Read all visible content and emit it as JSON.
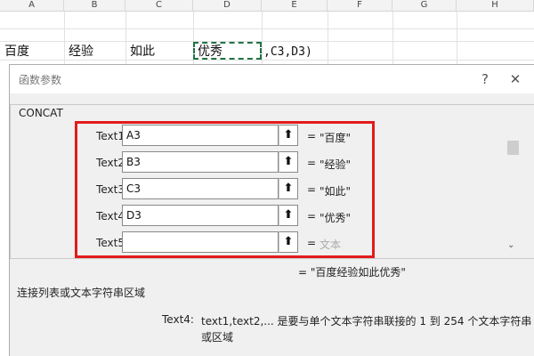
{
  "spreadsheet": {
    "columns": [
      "A",
      "B",
      "C",
      "D",
      "E",
      "F",
      "G",
      "H"
    ],
    "row3": [
      "百度",
      "经验",
      "如此",
      "优秀"
    ],
    "formula_overflow": ",C3,D3)"
  },
  "dialog": {
    "title": "函数参数",
    "help_label": "?",
    "close_label": "✕",
    "function_name": "CONCAT",
    "args": [
      {
        "label": "Text1",
        "value": "A3",
        "result": "\"百度\""
      },
      {
        "label": "Text2",
        "value": "B3",
        "result": "\"经验\""
      },
      {
        "label": "Text3",
        "value": "C3",
        "result": "\"如此\""
      },
      {
        "label": "Text4",
        "value": "D3",
        "result": "\"优秀\""
      },
      {
        "label": "Text5",
        "value": "",
        "result": "文本"
      }
    ],
    "equals_sign": "=",
    "collapse_icon": "⬆",
    "formula_result": "= \"百度经验如此优秀\"",
    "function_description": "连接列表或文本字符串区域",
    "param_name": "Text4:",
    "param_description": "text1,text2,... 是要与单个文本字符串联接的 1 到 254 个文本字符串或区域",
    "highlight_color": "#e21b1b"
  }
}
